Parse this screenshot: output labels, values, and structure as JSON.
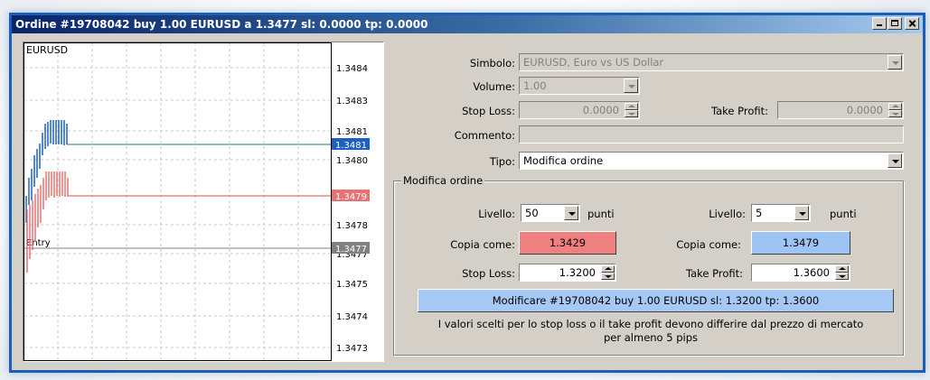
{
  "window": {
    "title": "Ordine #19708042 buy 1.00 EURUSD a 1.3477 sl: 0.0000 tp: 0.0000",
    "minimize_icon": "minimize-icon",
    "maximize_icon": "maximize-icon",
    "close_icon": "close-icon"
  },
  "chart": {
    "symbol": "EURUSD",
    "entry_label": "Entry",
    "axis_labels": [
      "1.3484",
      "1.3483",
      "1.3481",
      "1.3480",
      "1.3478",
      "1.3477",
      "1.3475",
      "1.3474",
      "1.3473"
    ],
    "ask_tag": "1.3481",
    "bid_tag": "1.3479",
    "entry_tag": "1.3477",
    "colors": {
      "ask": "#1f5fbf",
      "bid": "#e57373",
      "entry": "#808080",
      "grid": "#c8c8c8"
    }
  },
  "form": {
    "simbolo_label": "Simbolo:",
    "simbolo_value": "EURUSD, Euro vs US Dollar",
    "volume_label": "Volume:",
    "volume_value": "1.00",
    "stop_loss_label": "Stop Loss:",
    "stop_loss_value": "0.0000",
    "take_profit_label": "Take Profit:",
    "take_profit_value": "0.0000",
    "commento_label": "Commento:",
    "commento_value": "",
    "tipo_label": "Tipo:",
    "tipo_value": "Modifica ordine"
  },
  "modify": {
    "group_title": "Modifica ordine",
    "left": {
      "livello_label": "Livello:",
      "livello_value": "50",
      "unit": "punti",
      "copia_label": "Copia come:",
      "copia_value": "1.3429",
      "copia_color": "#f08080",
      "field_label": "Stop Loss:",
      "field_value": "1.3200"
    },
    "right": {
      "livello_label": "Livello:",
      "livello_value": "5",
      "unit": "punti",
      "copia_label": "Copia come:",
      "copia_value": "1.3479",
      "copia_color": "#9ec3f5",
      "field_label": "Take Profit:",
      "field_value": "1.3600"
    },
    "submit_label": "Modificare #19708042 buy 1.00 EURUSD sl: 1.3200 tp: 1.3600",
    "note_line1": "I valori scelti per lo stop loss o il take profit devono differire dal prezzo di mercato",
    "note_line2": "per almeno 5 pips"
  }
}
